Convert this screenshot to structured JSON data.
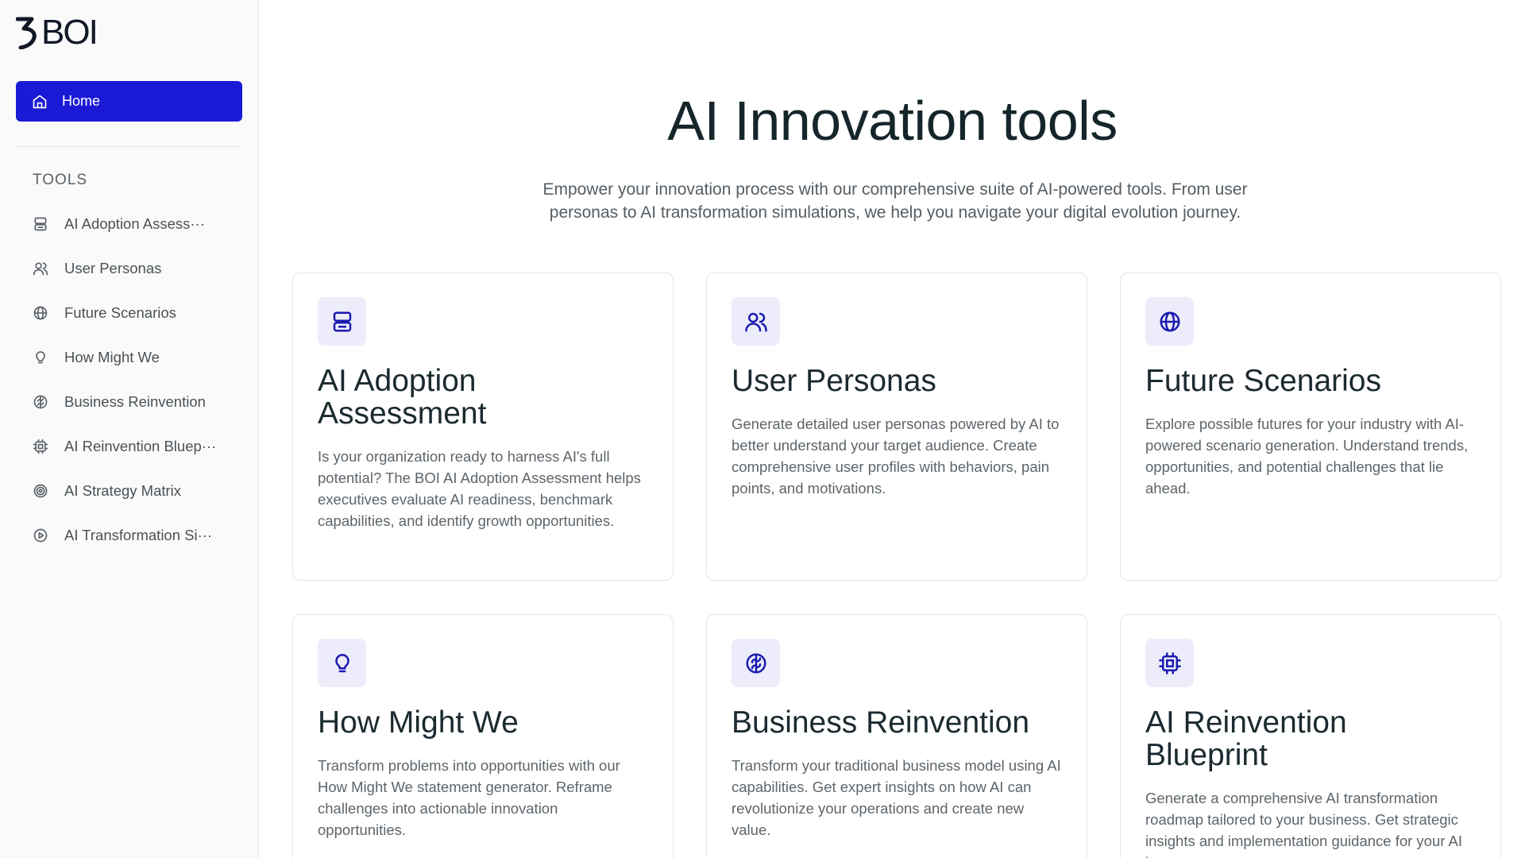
{
  "brand": {
    "name": "BOI"
  },
  "sidebar": {
    "home_label": "Home",
    "section_label": "TOOLS",
    "items": [
      {
        "label": "AI Adoption Assess···",
        "icon": "server-icon"
      },
      {
        "label": "User Personas",
        "icon": "users-icon"
      },
      {
        "label": "Future Scenarios",
        "icon": "globe-icon"
      },
      {
        "label": "How Might We",
        "icon": "lightbulb-icon"
      },
      {
        "label": "Business Reinvention",
        "icon": "brain-icon"
      },
      {
        "label": "AI Reinvention Bluep···",
        "icon": "cpu-icon"
      },
      {
        "label": "AI Strategy Matrix",
        "icon": "target-icon"
      },
      {
        "label": "AI Transformation Si···",
        "icon": "play-circle-icon"
      }
    ]
  },
  "main": {
    "title": "AI Innovation tools",
    "subtitle": "Empower your innovation process with our comprehensive suite of AI-powered tools. From user personas to AI transformation simulations, we help you navigate your digital evolution journey.",
    "cards": [
      {
        "title": "AI Adoption Assessment",
        "icon": "server-icon",
        "description": "Is your organization ready to harness AI's full potential? The BOI AI Adoption Assessment helps executives evaluate AI readiness, benchmark capabilities, and identify growth opportunities."
      },
      {
        "title": "User Personas",
        "icon": "users-icon",
        "description": "Generate detailed user personas powered by AI to better understand your target audience. Create comprehensive user profiles with behaviors, pain points, and motivations."
      },
      {
        "title": "Future Scenarios",
        "icon": "globe-icon",
        "description": "Explore possible futures for your industry with AI-powered scenario generation. Understand trends, opportunities, and potential challenges that lie ahead."
      },
      {
        "title": "How Might We",
        "icon": "lightbulb-icon",
        "description": "Transform problems into opportunities with our How Might We statement generator. Reframe challenges into actionable innovation opportunities."
      },
      {
        "title": "Business Reinvention",
        "icon": "brain-icon",
        "description": "Transform your traditional business model using AI capabilities. Get expert insights on how AI can revolutionize your operations and create new value."
      },
      {
        "title": "AI Reinvention Blueprint",
        "icon": "cpu-icon",
        "description": "Generate a comprehensive AI transformation roadmap tailored to your business. Get strategic insights and implementation guidance for your AI journey."
      }
    ]
  },
  "colors": {
    "accent": "#1a1ad6",
    "icon_bg": "#ececfb",
    "icon_fg": "#1a1ab0"
  }
}
